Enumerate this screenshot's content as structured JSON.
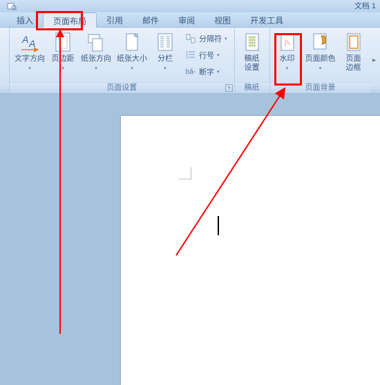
{
  "title": "文档 1",
  "tabs": {
    "insert": "插入",
    "layout": "页面布局",
    "references": "引用",
    "mail": "邮件",
    "review": "审阅",
    "view": "视图",
    "dev": "开发工具"
  },
  "groups": {
    "page_setup": {
      "label": "页面设置",
      "text_dir": "文字方向",
      "margins": "页边距",
      "orientation": "纸张方向",
      "size": "纸张大小",
      "columns": "分栏",
      "breaks": "分隔符",
      "lines": "行号",
      "hyphen": "断字"
    },
    "drafts": {
      "label": "稿纸",
      "draft": "稿纸\n设置"
    },
    "background": {
      "label": "页面背景",
      "watermark": "水印",
      "color": "页面颜色",
      "border": "页面\n边框"
    }
  }
}
